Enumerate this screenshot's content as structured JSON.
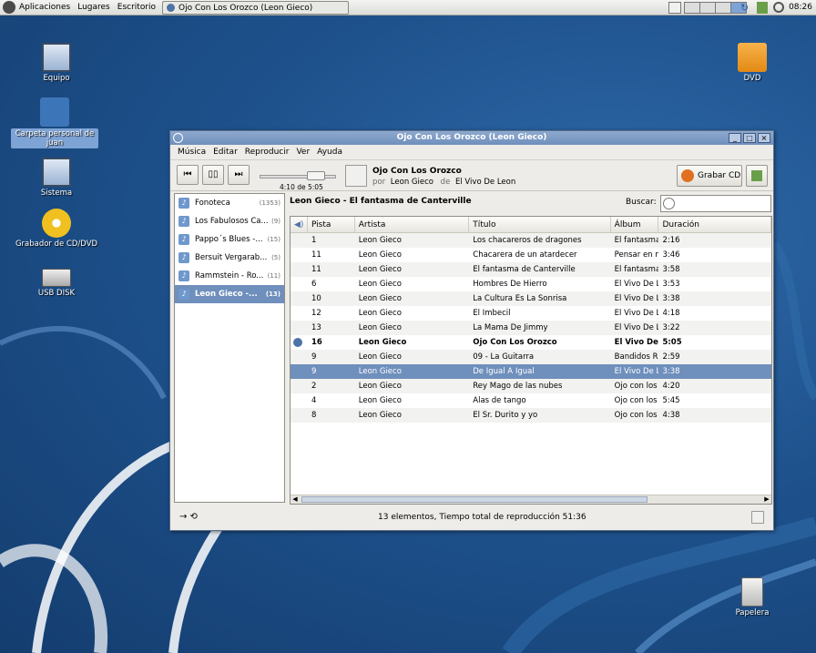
{
  "panel": {
    "menus": [
      "Aplicaciones",
      "Lugares",
      "Escritorio"
    ],
    "task_title": "Ojo Con Los Orozco (Leon Gieco)",
    "clock": "08:26"
  },
  "desktop": {
    "icons": [
      {
        "label": "Equipo"
      },
      {
        "label": "Carpeta personal de juan"
      },
      {
        "label": "Sistema"
      },
      {
        "label": "Grabador de CD/DVD"
      },
      {
        "label": "USB DISK"
      },
      {
        "label": "DVD"
      },
      {
        "label": "Papelera"
      }
    ]
  },
  "window": {
    "title": "Ojo Con Los Orozco (Leon Gieco)",
    "menu": [
      "Música",
      "Editar",
      "Reproducir",
      "Ver",
      "Ayuda"
    ],
    "player": {
      "time": "4:10 de 5:05",
      "progress": 0.82,
      "song": "Ojo Con Los Orozco",
      "by_label": "por",
      "artist": "Leon Gieco",
      "of_label": "de",
      "album": "El Vivo De Leon",
      "grab_label": "Grabar CD"
    },
    "sources": [
      {
        "label": "Fonoteca",
        "count": "(1353)"
      },
      {
        "label": "Los Fabulosos Ca...",
        "count": "(9)"
      },
      {
        "label": "Pappo´s Blues -...",
        "count": "(15)"
      },
      {
        "label": "Bersuit Vergarab...",
        "count": "(5)"
      },
      {
        "label": "Rammstein - Ro...",
        "count": "(11)"
      },
      {
        "label": "Leon Gieco -...",
        "count": "(13)"
      }
    ],
    "playlist_title": "Leon Gieco - El fantasma de Canterville",
    "search_label": "Buscar:",
    "columns": [
      "Pista",
      "Artista",
      "Título",
      "Álbum",
      "Duración"
    ],
    "tracks": [
      {
        "pista": "1",
        "artista": "Leon Gieco",
        "titulo": "Los chacareros de dragones",
        "album": "El fantasma",
        "duracion": "2:16"
      },
      {
        "pista": "11",
        "artista": "Leon Gieco",
        "titulo": "Chacarera de un atardecer",
        "album": "Pensar en n",
        "duracion": "3:46"
      },
      {
        "pista": "11",
        "artista": "Leon Gieco",
        "titulo": "El fantasma de Canterville",
        "album": "El fantasma",
        "duracion": "3:58"
      },
      {
        "pista": "6",
        "artista": "Leon Gieco",
        "titulo": "Hombres De Hierro",
        "album": "El Vivo De L",
        "duracion": "3:53"
      },
      {
        "pista": "10",
        "artista": "Leon Gieco",
        "titulo": "La Cultura Es La Sonrisa",
        "album": "El Vivo De L",
        "duracion": "3:38"
      },
      {
        "pista": "12",
        "artista": "Leon Gieco",
        "titulo": "El Imbecil",
        "album": "El Vivo De L",
        "duracion": "4:18"
      },
      {
        "pista": "13",
        "artista": "Leon Gieco",
        "titulo": "La Mama De Jimmy",
        "album": "El Vivo De L",
        "duracion": "3:22"
      },
      {
        "pista": "16",
        "artista": "Leon Gieco",
        "titulo": "Ojo Con Los Orozco",
        "album": "El Vivo De",
        "duracion": "5:05"
      },
      {
        "pista": "9",
        "artista": "Leon Gieco",
        "titulo": "09 - La Guitarra",
        "album": "Bandidos R",
        "duracion": "2:59"
      },
      {
        "pista": "9",
        "artista": "Leon Gieco",
        "titulo": "De Igual A Igual",
        "album": "El Vivo De L",
        "duracion": "3:38"
      },
      {
        "pista": "2",
        "artista": "Leon Gieco",
        "titulo": "Rey Mago de las nubes",
        "album": "Ojo con los",
        "duracion": "4:20"
      },
      {
        "pista": "4",
        "artista": "Leon Gieco",
        "titulo": "Alas de tango",
        "album": "Ojo con los",
        "duracion": "5:45"
      },
      {
        "pista": "8",
        "artista": "Leon Gieco",
        "titulo": "El Sr. Durito y yo",
        "album": "Ojo con los",
        "duracion": "4:38"
      }
    ],
    "playing_index": 7,
    "selected_index": 9,
    "status": "13 elementos, Tiempo total de reproducción 51:36"
  }
}
